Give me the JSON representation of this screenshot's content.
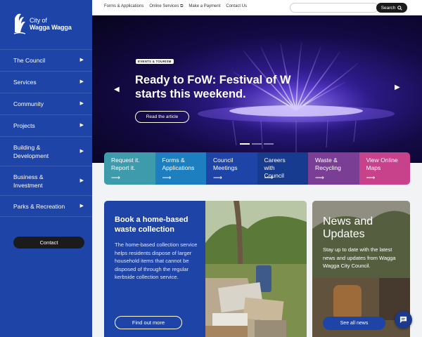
{
  "brand": {
    "line1": "City of",
    "line2": "Wagga Wagga"
  },
  "sidebar": {
    "items": [
      {
        "label": "The Council"
      },
      {
        "label": "Services"
      },
      {
        "label": "Community"
      },
      {
        "label": "Projects"
      },
      {
        "label": "Building & Development"
      },
      {
        "label": "Business & Investment"
      },
      {
        "label": "Parks & Recreation"
      }
    ],
    "contact_label": "Contact"
  },
  "topbar": {
    "links": [
      "Forms & Applications",
      "Online Services",
      "Make a Payment",
      "Contact Us"
    ],
    "search_placeholder": "",
    "search_label": "Search"
  },
  "hero": {
    "badge": "EVENTS & TOURISM",
    "title": "Ready to FoW: Festival of W starts this weekend.",
    "button": "Read the article"
  },
  "quick_links": [
    {
      "label": "Request it. Report it.",
      "color": "#3e9bab"
    },
    {
      "label": "Forms & Applications",
      "color": "#1d7fc0"
    },
    {
      "label": "Council Meetings",
      "color": "#1e44a8"
    },
    {
      "label": "Careers with Council",
      "color": "#163b8f"
    },
    {
      "label": "Waste & Recycling",
      "color": "#7a3f95"
    },
    {
      "label": "View Online Maps",
      "color": "#c8418b"
    }
  ],
  "waste_card": {
    "title": "Book a home-based waste collection",
    "body": "The home-based collection service helps residents dispose of larger household items that cannot be disposed of through the regular kerbside collection service.",
    "button": "Find out more"
  },
  "news_card": {
    "title": "News and Updates",
    "body": "Stay up to date with the latest news and updates from Wagga Wagga City Council.",
    "button": "See all news"
  },
  "icons": {
    "external": "external-link-icon",
    "search": "search-icon",
    "chat": "chat-icon",
    "chevron": "chevron-right-icon",
    "arrow": "arrow-right-icon"
  }
}
